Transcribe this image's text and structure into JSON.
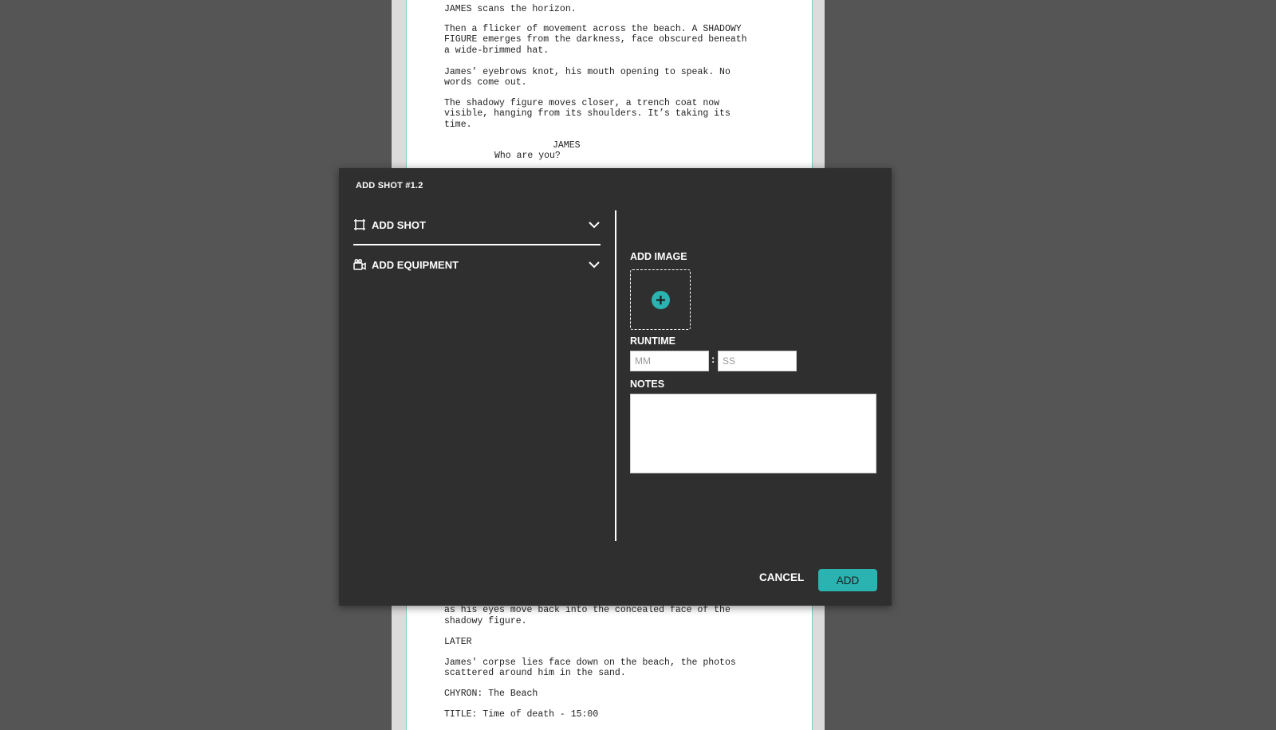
{
  "script": {
    "top_lines": [
      "JAMES scans the horizon.",
      "Then a flicker of movement across the beach. A SHADOWY",
      "FIGURE emerges from the darkness, face obscured beneath",
      "a wide-brimmed hat.",
      "James’ eyebrows knot, his mouth opening to speak. No",
      "words come out.",
      "The shadowy figure moves closer, a trench coat now",
      "visible, hanging from its shoulders. It’s taking its",
      "time."
    ],
    "character": "JAMES",
    "dialogue": "Who are you?",
    "bottom_lines": [
      "as his eyes move back into the concealed face of the",
      "shadowy figure.",
      "LATER",
      "James' corpse lies face down on the beach, the photos",
      "scattered around him in the sand.",
      "CHYRON: The Beach",
      "TITLE: Time of death - 15:00"
    ]
  },
  "modal": {
    "title": "ADD SHOT #1.2",
    "sections": [
      {
        "label": "ADD SHOT",
        "icon": "frame-icon"
      },
      {
        "label": "ADD EQUIPMENT",
        "icon": "camera-icon"
      }
    ],
    "add_image_label": "ADD IMAGE",
    "runtime_label": "RUNTIME",
    "runtime_separator": ":",
    "runtime_mm_placeholder": "MM",
    "runtime_ss_placeholder": "SS",
    "notes_label": "NOTES",
    "cancel_label": "CANCEL",
    "add_label": "ADD",
    "accent_color": "#2ab3b0"
  }
}
